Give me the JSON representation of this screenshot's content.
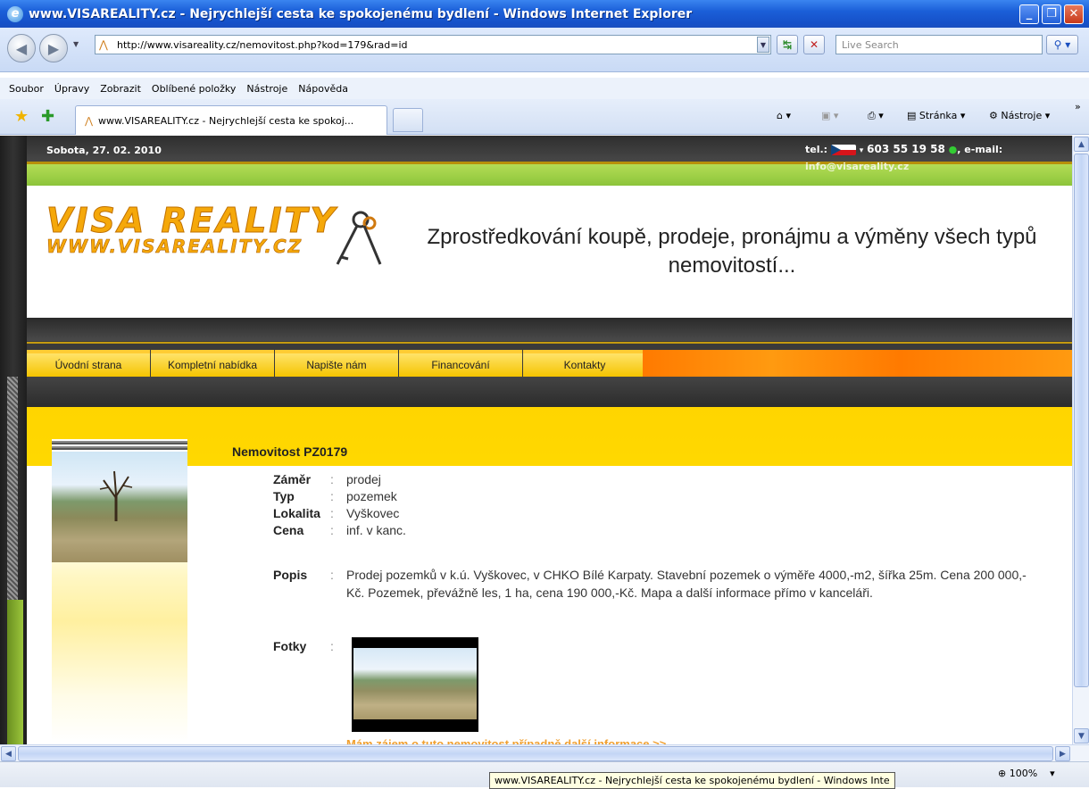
{
  "window": {
    "title": "www.VISAREALITY.cz - Nejrychlejší cesta ke spokojenému bydlení - Windows Internet Explorer",
    "minimize": "_",
    "maximize": "❐",
    "close": "✕"
  },
  "address": {
    "url": "http://www.visareality.cz/nemovitost.php?kod=179&rad=id",
    "search_placeholder": "Live Search"
  },
  "menu": [
    "Soubor",
    "Úpravy",
    "Zobrazit",
    "Oblíbené položky",
    "Nástroje",
    "Nápověda"
  ],
  "tab": {
    "title": "www.VISAREALITY.cz - Nejrychlejší cesta ke spokoj..."
  },
  "commands": {
    "page": "Stránka",
    "tools": "Nástroje"
  },
  "site": {
    "date": "Sobota, 27. 02. 2010",
    "tel_label": "tel.:",
    "phone": "603 55 19 58",
    "email_label": ", e-mail:",
    "email": "info@visareality.cz",
    "logo_main": "VISA REALITY",
    "logo_sub": "WWW.VISAREALITY.CZ",
    "tagline": "Zprostředkování koupě, prodeje, pronájmu a výměny všech typů nemovitostí...",
    "nav": [
      "Úvodní strana",
      "Kompletní nabídka",
      "Napište nám",
      "Financování",
      "Kontakty"
    ]
  },
  "property": {
    "title": "Nemovitost PZ0179",
    "fields": [
      {
        "label": "Záměr",
        "value": "prodej"
      },
      {
        "label": "Typ",
        "value": "pozemek"
      },
      {
        "label": "Lokalita",
        "value": "Vyškovec"
      },
      {
        "label": "Cena",
        "value": "inf. v kanc."
      }
    ],
    "desc_label": "Popis",
    "description": "Prodej pozemků v k.ú. Vyškovec, v CHKO Bílé Karpaty. Stavební pozemek o výměře 4000,-m2, šířka 25m. Cena 200 000,-Kč. Pozemek, převážně les, 1 ha, cena 190 000,-Kč. Mapa a další informace přímo v kanceláři.",
    "photos_label": "Fotky",
    "interest_link": "Mám zájem o tuto nemovitost případně další informace >>"
  },
  "status": {
    "tooltip": "www.VISAREALITY.cz - Nejrychlejší cesta ke spokojenému bydlení - Windows Inte",
    "zoom": "100%"
  }
}
